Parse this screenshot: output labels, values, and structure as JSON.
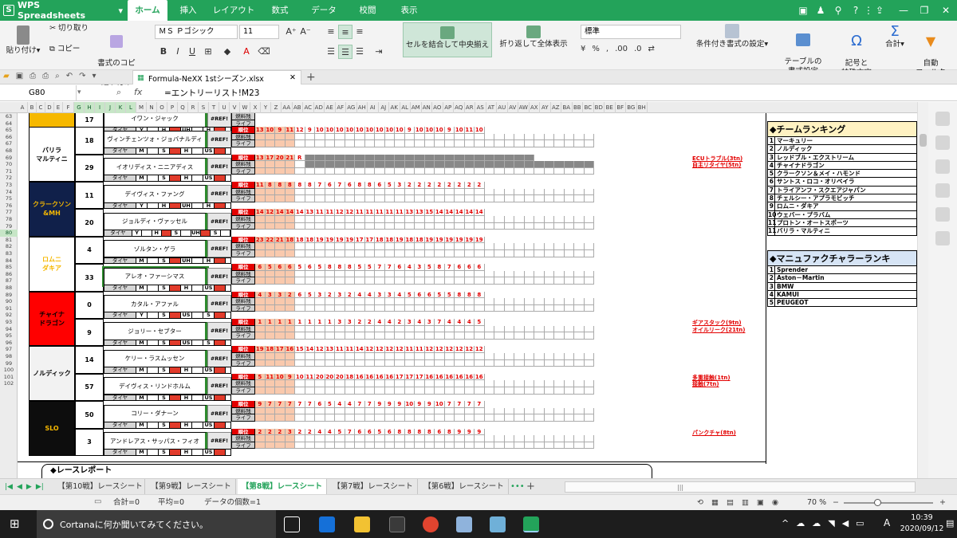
{
  "app": {
    "title": "WPS Spreadsheets",
    "menu_tabs": [
      "ホーム",
      "挿入",
      "レイアウト",
      "数式",
      "データ",
      "校閲",
      "表示"
    ],
    "active_tab": "ホーム"
  },
  "ribbon": {
    "paste": "貼り付け",
    "cut": "切り取り",
    "copy": "コピー",
    "format_painter": "書式のコピー\n貼り付け",
    "font_name": "ＭＳ Ｐゴシック",
    "font_size": "11",
    "merge_center": "セルを結合して中央揃え",
    "wrap_text": "折り返して全体表示",
    "number_format": "標準",
    "conditional_format": "条件付き書式の設定",
    "table_style": "テーブルの\n書式設定",
    "symbol": "記号と\n特殊文字",
    "sum": "合計",
    "filter": "自動\nフィルタ"
  },
  "file_tab": {
    "name": "Formula-NeXX 1stシーズン.xlsx"
  },
  "formula_bar": {
    "cell_ref": "G80",
    "fx": "fx",
    "formula": "=エントリーリスト!M23"
  },
  "columns": [
    "A",
    "B",
    "C",
    "D",
    "E",
    "F",
    "G",
    "H",
    "I",
    "J",
    "K",
    "L",
    "M",
    "N",
    "O",
    "P",
    "Q",
    "R",
    "S",
    "T",
    "U",
    "V",
    "W",
    "X",
    "Y",
    "Z",
    "AA",
    "AB",
    "AC",
    "AD",
    "AE",
    "AF",
    "AG",
    "AH",
    "AI",
    "AJ",
    "AK",
    "AL",
    "AM",
    "AN",
    "AO",
    "AP",
    "AQ",
    "AR",
    "AS",
    "AT",
    "AU",
    "AV",
    "AW",
    "AX",
    "AY",
    "AZ",
    "BA",
    "BB",
    "BC",
    "BD",
    "BE",
    "BF",
    "BG",
    "BH"
  ],
  "rows": [
    63,
    64,
    65,
    66,
    67,
    68,
    69,
    70,
    71,
    72,
    73,
    74,
    75,
    76,
    77,
    78,
    79,
    80,
    81,
    82,
    83,
    84,
    85,
    86,
    87,
    88,
    89,
    90,
    91,
    92,
    93,
    94,
    95,
    96,
    97,
    98,
    99,
    100,
    101,
    102
  ],
  "labels": {
    "pos": "順位",
    "fuel": "燃料残",
    "life": "ライフ",
    "tire": "タイヤ",
    "ref": "#REF!"
  },
  "teams": [
    {
      "name": "",
      "bg": "#f6b800",
      "fg": "#000",
      "cars": [
        {
          "no": "17",
          "driver": "イワン・ジャック",
          "tires": [
            "Y",
            "H",
            "UH",
            "H"
          ]
        }
      ]
    },
    {
      "name": "バリラ\nマルティニ",
      "bg": "#ffffff",
      "fg": "#000",
      "cars": [
        {
          "no": "18",
          "driver": "ヴィンチェンツォ・ジョバナルディ",
          "tires": [
            "M",
            "S",
            "H",
            "US"
          ],
          "pos": [
            "13",
            "10",
            "9",
            "11",
            "12",
            "9",
            "10",
            "10",
            "10",
            "10",
            "10",
            "10",
            "10",
            "10",
            "10",
            "9",
            "10",
            "10",
            "10",
            "9",
            "10",
            "11",
            "10"
          ],
          "notes": []
        },
        {
          "no": "29",
          "driver": "イオリディス・ニニアディス",
          "tires": [
            "M",
            "S",
            "H",
            "US"
          ],
          "pos": [
            "13",
            "17",
            "20",
            "21",
            "R"
          ],
          "notes": [
            "ECUトラブル(3tn)",
            "自主リタイヤ(5tn)"
          ]
        }
      ]
    },
    {
      "name": "クラークソン\n&MH",
      "bg": "#10204a",
      "fg": "#f6b800",
      "cars": [
        {
          "no": "11",
          "driver": "デイヴィス・ファング",
          "tires": [
            "Y",
            "H",
            "UH",
            "H"
          ],
          "pos": [
            "11",
            "8",
            "8",
            "8",
            "8",
            "8",
            "7",
            "6",
            "7",
            "6",
            "8",
            "8",
            "6",
            "5",
            "3",
            "2",
            "2",
            "2",
            "2",
            "2",
            "2",
            "2",
            "2"
          ],
          "notes": []
        },
        {
          "no": "20",
          "driver": "ジョルディ・ヴァッセル",
          "tires": [
            "Y",
            "H",
            "S",
            "UH",
            "S"
          ],
          "pos": [
            "14",
            "12",
            "14",
            "14",
            "14",
            "13",
            "11",
            "11",
            "12",
            "12",
            "11",
            "11",
            "11",
            "11",
            "11",
            "13",
            "13",
            "15",
            "14",
            "14",
            "14",
            "14",
            "14"
          ],
          "notes": []
        }
      ]
    },
    {
      "name": "ロムニ\nダキア",
      "bg": "#ffffff",
      "fg": "#f6b800",
      "cars": [
        {
          "no": "4",
          "driver": "ゾルタン・ゲラ",
          "tires": [
            "M",
            "S",
            "UH",
            "H"
          ],
          "pos": [
            "23",
            "22",
            "21",
            "18",
            "18",
            "18",
            "19",
            "19",
            "19",
            "19",
            "17",
            "17",
            "18",
            "18",
            "19",
            "18",
            "18",
            "19",
            "19",
            "19",
            "19",
            "19",
            "19"
          ],
          "notes": []
        },
        {
          "no": "33",
          "driver": "アレオ・ファーシマス",
          "tires": [
            "M",
            "S",
            "H",
            "US"
          ],
          "pos": [
            "6",
            "5",
            "6",
            "6",
            "5",
            "6",
            "5",
            "8",
            "8",
            "8",
            "5",
            "5",
            "7",
            "7",
            "6",
            "4",
            "3",
            "5",
            "8",
            "7",
            "6",
            "6",
            "6"
          ],
          "notes": []
        }
      ]
    },
    {
      "name": "チャイナ\nドラゴン",
      "bg": "#ff0000",
      "fg": "#000",
      "cars": [
        {
          "no": "0",
          "driver": "カタル・アファル",
          "tires": [
            "Y",
            "S",
            "US",
            "S"
          ],
          "pos": [
            "4",
            "3",
            "3",
            "2",
            "6",
            "5",
            "3",
            "2",
            "3",
            "2",
            "4",
            "4",
            "3",
            "3",
            "4",
            "5",
            "6",
            "6",
            "5",
            "5",
            "8",
            "8",
            "8"
          ],
          "notes": []
        },
        {
          "no": "9",
          "driver": "ジョリー・セブター",
          "tires": [
            "M",
            "S",
            "US",
            "S"
          ],
          "pos": [
            "1",
            "1",
            "1",
            "1",
            "1",
            "1",
            "1",
            "1",
            "3",
            "3",
            "2",
            "2",
            "4",
            "4",
            "2",
            "3",
            "4",
            "3",
            "7",
            "4",
            "4",
            "4",
            "5"
          ],
          "notes": [
            "ギアスタック(9tn)",
            "オイルリーク(21tn)"
          ]
        }
      ]
    },
    {
      "name": "ノルディック",
      "bg": "#f2f2f2",
      "fg": "#000",
      "cars": [
        {
          "no": "14",
          "driver": "ケリー・ラスムッセン",
          "tires": [
            "M",
            "S",
            "H",
            "US"
          ],
          "pos": [
            "19",
            "18",
            "17",
            "16",
            "15",
            "14",
            "12",
            "13",
            "11",
            "11",
            "14",
            "12",
            "12",
            "12",
            "12",
            "11",
            "11",
            "12",
            "12",
            "12",
            "12",
            "12",
            "12"
          ],
          "notes": []
        },
        {
          "no": "57",
          "driver": "デイヴィス・リンドホルム",
          "tires": [
            "M",
            "S",
            "H",
            "US"
          ],
          "pos": [
            "5",
            "11",
            "10",
            "9",
            "10",
            "11",
            "20",
            "20",
            "20",
            "18",
            "16",
            "16",
            "16",
            "16",
            "17",
            "17",
            "17",
            "16",
            "16",
            "16",
            "16",
            "16",
            "16"
          ],
          "notes": [
            "多重接触(1tn)",
            "接触(7tn)"
          ]
        }
      ]
    },
    {
      "name": "SLO",
      "bg": "#0d0d0d",
      "fg": "#f6b800",
      "cars": [
        {
          "no": "50",
          "driver": "コリー・ダナーン",
          "tires": [
            "M",
            "S",
            "H",
            "US"
          ],
          "pos": [
            "9",
            "7",
            "7",
            "7",
            "7",
            "7",
            "6",
            "5",
            "4",
            "4",
            "7",
            "7",
            "9",
            "9",
            "9",
            "10",
            "9",
            "9",
            "10",
            "7",
            "7",
            "7",
            "7"
          ],
          "notes": []
        },
        {
          "no": "3",
          "driver": "アンドレアス・サッパス・フィオ",
          "tires": [
            "M",
            "S",
            "H",
            "US"
          ],
          "pos": [
            "2",
            "2",
            "2",
            "3",
            "2",
            "2",
            "4",
            "4",
            "5",
            "7",
            "6",
            "6",
            "5",
            "6",
            "8",
            "8",
            "8",
            "8",
            "6",
            "8",
            "9",
            "9",
            "9"
          ],
          "notes": [
            "パンクチャ(8tn)"
          ]
        }
      ]
    }
  ],
  "team_ranking": {
    "title": "◆チームランキング",
    "rows": [
      {
        "rank": "1",
        "name": "マーキュリー"
      },
      {
        "rank": "2",
        "name": "ノルディック"
      },
      {
        "rank": "3",
        "name": "レッドブル・エクストリーム"
      },
      {
        "rank": "4",
        "name": "チャイナドラゴン"
      },
      {
        "rank": "5",
        "name": "クラークソン＆メイ・ハモンド"
      },
      {
        "rank": "6",
        "name": "サントス・ロコ・オリベイラ"
      },
      {
        "rank": "7",
        "name": "トライアンフ・スクエアジャパン"
      },
      {
        "rank": "8",
        "name": "チェルシー・アプラモビッチ"
      },
      {
        "rank": "9",
        "name": "ロムニ・ダキア"
      },
      {
        "rank": "10",
        "name": "ウェバー・プラバム"
      },
      {
        "rank": "11",
        "name": "プロトン・オートスポーツ"
      },
      {
        "rank": "11",
        "name": "バリラ・マルティニ"
      }
    ]
  },
  "manufacturer_ranking": {
    "title": "◆マニュファクチャラーランキ",
    "rows": [
      {
        "rank": "1",
        "name": "Sprender"
      },
      {
        "rank": "2",
        "name": "Aston－Martin"
      },
      {
        "rank": "3",
        "name": "BMW"
      },
      {
        "rank": "4",
        "name": "KAMUI"
      },
      {
        "rank": "5",
        "name": "PEUGEOT"
      }
    ]
  },
  "race_report": "◆レースレポート",
  "sheet_tabs": [
    "【第10戦】レースシート",
    "【第9戦】レースシート",
    "【第8戦】レースシート",
    "【第7戦】レースシート",
    "【第6戦】レースシート"
  ],
  "active_sheet": "【第8戦】レースシート",
  "status": {
    "sum": "合計=0",
    "avg": "平均=0",
    "count": "データの個数=1",
    "zoom": "70 %"
  },
  "taskbar": {
    "search": "Cortanaに何か聞いてみてください。",
    "time": "10:39",
    "date": "2020/09/12",
    "ime": "A"
  },
  "colors": {
    "accent": "#23a35a",
    "red": "#e30000",
    "peach": "#f9c9ad"
  }
}
